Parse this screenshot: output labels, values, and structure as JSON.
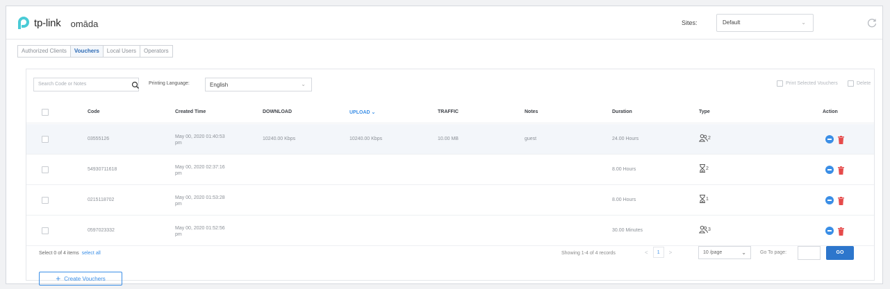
{
  "brand": {
    "logo_text": "tp-link",
    "product": "omāda"
  },
  "header": {
    "sites_label": "Sites:",
    "site_value": "Default"
  },
  "tabs": [
    {
      "label": "Authorized Clients",
      "active": false
    },
    {
      "label": "Vouchers",
      "active": true
    },
    {
      "label": "Local Users",
      "active": false
    },
    {
      "label": "Operators",
      "active": false
    }
  ],
  "toolbar": {
    "search_placeholder": "Search Code or Notes",
    "printing_language_label": "Printing Language:",
    "printing_language_value": "English",
    "print_selected_label": "Print Selected Vouchers",
    "delete_label": "Delete"
  },
  "table": {
    "columns": [
      "Code",
      "Created Time",
      "DOWNLOAD",
      "UPLOAD",
      "TRAFFIC",
      "Notes",
      "Duration",
      "Type",
      "Action"
    ],
    "sorted_column": "UPLOAD",
    "rows": [
      {
        "code": "03555126",
        "created_time": "May 00, 2020 01:40:53 pm",
        "download": "10240.00 Kbps",
        "upload": "10240.00 Kbps",
        "traffic": "10.00 MB",
        "notes": "guest",
        "duration": "24.00 Hours",
        "type_icon": "users-icon",
        "type_count": "2"
      },
      {
        "code": "54930711618",
        "created_time": "May 00, 2020 02:37:16 pm",
        "download": "",
        "upload": "",
        "traffic": "",
        "notes": "",
        "duration": "8.00 Hours",
        "type_icon": "hourglass-icon",
        "type_count": "2"
      },
      {
        "code": "0215118702",
        "created_time": "May 00, 2020 01:53:28 pm",
        "download": "",
        "upload": "",
        "traffic": "",
        "notes": "",
        "duration": "8.00 Hours",
        "type_icon": "hourglass-icon",
        "type_count": "1"
      },
      {
        "code": "0597023332",
        "created_time": "May 00, 2020 01:52:56 pm",
        "download": "",
        "upload": "",
        "traffic": "",
        "notes": "",
        "duration": "30.00 Minutes",
        "type_icon": "users-icon",
        "type_count": "3"
      }
    ]
  },
  "footer": {
    "selected_text": "Select 0 of 4 items",
    "select_all": "select all",
    "showing": "Showing 1-4 of 4 records",
    "current_page": "1",
    "per_page": "10 /page",
    "goto_label": "Go To page:",
    "go_label": "GO",
    "create_label": "Create Vouchers"
  },
  "colors": {
    "accent": "#3a8ee6",
    "primary_button": "#2d76cc",
    "delete": "#e64b4b",
    "logo": "#4acbd6"
  }
}
